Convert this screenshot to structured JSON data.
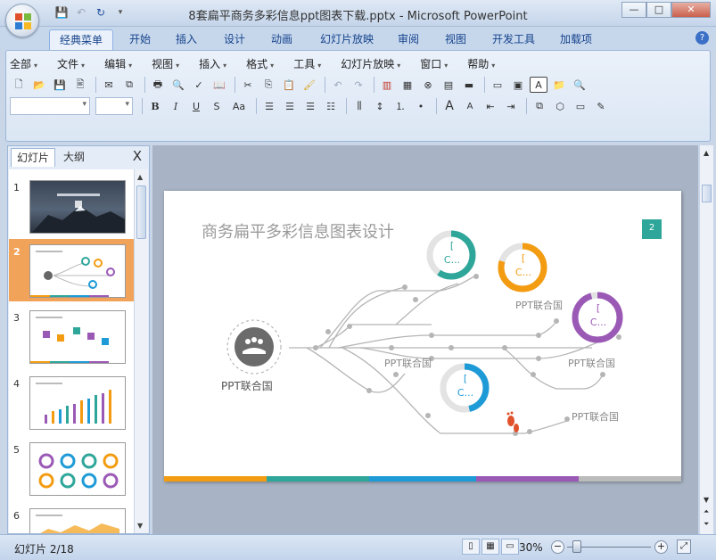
{
  "window": {
    "title": "8套扁平商务多彩信息ppt图表下载.pptx - Microsoft PowerPoint",
    "minimize": "—",
    "maximize": "□",
    "close": "✕"
  },
  "quick_access": [
    "save-icon",
    "undo-icon",
    "redo-icon",
    "customize-icon"
  ],
  "ribbon_tabs": [
    {
      "label": "经典菜单",
      "active": true
    },
    {
      "label": "开始"
    },
    {
      "label": "插入"
    },
    {
      "label": "设计"
    },
    {
      "label": "动画"
    },
    {
      "label": "幻灯片放映"
    },
    {
      "label": "审阅"
    },
    {
      "label": "视图"
    },
    {
      "label": "开发工具"
    },
    {
      "label": "加载项"
    }
  ],
  "menu": [
    "全部",
    "文件",
    "编辑",
    "视图",
    "插入",
    "格式",
    "工具",
    "幻灯片放映",
    "窗口",
    "帮助"
  ],
  "toolbar": {
    "bold": "B",
    "italic": "I",
    "underline": "U",
    "shadow": "S",
    "change_case": "Aa",
    "grow_font": "A",
    "shrink_font": "A",
    "text_box": "A"
  },
  "panel": {
    "tab_slides": "幻灯片",
    "tab_outline": "大纲",
    "close": "X",
    "thumbnails": [
      {
        "num": "1"
      },
      {
        "num": "2",
        "selected": true
      },
      {
        "num": "3"
      },
      {
        "num": "4"
      },
      {
        "num": "5"
      },
      {
        "num": "6"
      }
    ]
  },
  "slide": {
    "title": "商务扁平多彩信息图表设计",
    "page_number": "2",
    "center_label": "PPT联合国",
    "branch_labels": [
      "PPT联合国",
      "PPT联合国",
      "PPT联合国",
      "PPT联合国"
    ],
    "rings": [
      {
        "color": "#2fa69a",
        "text_top": "[",
        "text_bottom": "C..."
      },
      {
        "color": "#f39c12",
        "text_top": "[",
        "text_bottom": "C..."
      },
      {
        "color": "#9b59b6",
        "text_top": "[",
        "text_bottom": "C..."
      },
      {
        "color": "#1e9bd7",
        "text_top": "[",
        "text_bottom": "C..."
      }
    ],
    "bottom_colors": [
      "#f39c12",
      "#2fa69a",
      "#1e9bd7",
      "#9b59b6",
      "#bbbbbb"
    ]
  },
  "status": {
    "slide_info": "幻灯片 2/18",
    "zoom": "30%",
    "zoom_minus": "−",
    "zoom_plus": "+"
  }
}
